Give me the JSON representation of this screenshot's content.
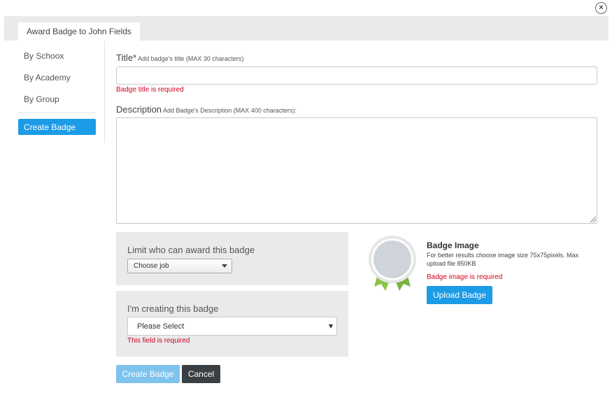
{
  "dialog": {
    "tab_title": "Award Badge to John Fields",
    "close_symbol": "×"
  },
  "sidebar": {
    "items": [
      {
        "label": "By Schoox"
      },
      {
        "label": "By Academy"
      },
      {
        "label": "By Group"
      }
    ],
    "active_item": {
      "label": "Create Badge"
    }
  },
  "form": {
    "title": {
      "label": "Title*",
      "hint": "Add badge's title (MAX 30 characters)",
      "value": "",
      "error": "Badge title is required"
    },
    "description": {
      "label": "Description",
      "hint": "Add Badge's Description (MAX 400 characters):",
      "value": ""
    },
    "limit_panel": {
      "title": "Limit who can award this badge",
      "select_value": "Choose job"
    },
    "creator_panel": {
      "title": "I'm creating this badge",
      "select_value": "Please Select",
      "error": "This field is required"
    },
    "badge_image": {
      "heading": "Badge Image",
      "hint": "For better results choose image size 75x75pixels. Max upload file 850KB",
      "error": "Badge image is required",
      "upload_label": "Upload Badge"
    },
    "actions": {
      "create_label": "Create Badge",
      "cancel_label": "Cancel"
    }
  },
  "colors": {
    "accent": "#1c9be6",
    "accent_disabled": "#7ec3ee",
    "error": "#d0021b",
    "dark_button": "#3a3f44",
    "panel_bg": "#e9eaec",
    "badge_ribbon": "#8bc34a"
  }
}
